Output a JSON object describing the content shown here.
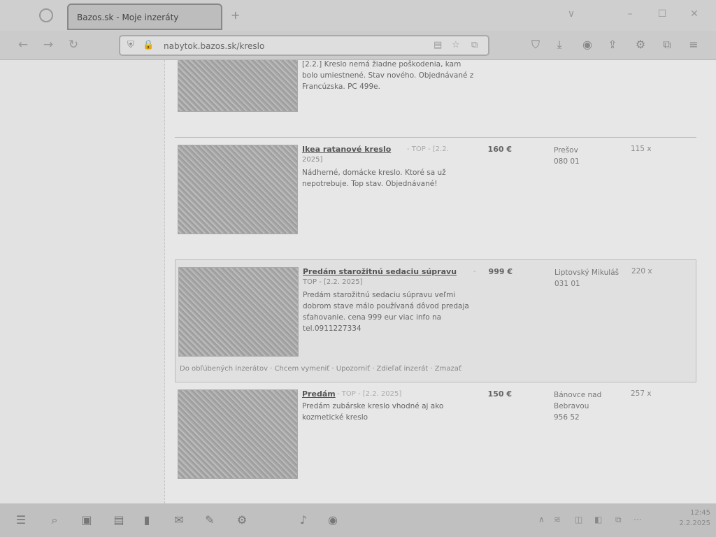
{
  "browser": {
    "tab_title": "Bazos.sk - Moje inzeráty",
    "new_tab": "+",
    "url": "nabytok.bazos.sk/kreslo",
    "window_controls": [
      "∨",
      "–",
      "☐",
      "✕"
    ],
    "icons": {
      "back": "←",
      "forward": "→",
      "reload": "↻",
      "shield": "⛨",
      "reader": "▤",
      "star": "☆",
      "extension": "⧉",
      "pocket": "⛉",
      "download": "⤓",
      "account": "◉",
      "lock": "🔒",
      "share": "⇪",
      "settings": "⚙",
      "menu": "≡"
    }
  },
  "listings": [
    {
      "partial": true,
      "desc": "[2.2.] Kreslo nemá žiadne poškodenia, kam bolo umiestnené. Stav nového. Objednávané z Francúzska. PC 499e."
    },
    {
      "title": "Ikea ratanové kreslo",
      "top": "- TOP - [2.2.",
      "date_cont": "2025]",
      "desc": "Nádherné, domácke kreslo. Ktoré sa už nepotrebuje. Top stav. Objednávané!",
      "price": "160 €",
      "location": "Prešov",
      "zip": "080 01",
      "views": "115 x"
    },
    {
      "title": "Predám starožitnú sedaciu súpravu",
      "top": "-",
      "date": "TOP - [2.2. 2025]",
      "desc": "Predám starožitnú sedaciu súpravu veľmi dobrom stave málo používaná dôvod predaja sťahovanie. cena 999 eur viac info na tel.0911227334",
      "price": "999 €",
      "location": "Liptovský Mikuláš",
      "zip": "031 01",
      "views": "220 x",
      "actions": "Do obľúbených inzerátov · Chcem vymeniť · Upozorniť · Zdieľať inzerát · Zmazať"
    },
    {
      "title": "Predám",
      "top": "- TOP - [2.2. 2025]",
      "desc": "Predám zubárske kreslo vhodné aj ako kozmetické kreslo",
      "price": "150 €",
      "location": "Bánovce nad Bebravou",
      "zip": "956 52",
      "views": "257 x"
    }
  ],
  "taskbar": {
    "icons": [
      "start-icon",
      "search-icon",
      "files-icon",
      "folder-icon",
      "terminal-icon",
      "store-icon",
      "mail-icon",
      "settings-icon",
      "music-icon",
      "browser-icon"
    ],
    "glyphs": [
      "☰",
      "⌕",
      "▣",
      "▤",
      "▮",
      "✉",
      "✎",
      "⚙",
      "♪",
      "◉"
    ],
    "tray": [
      "∧",
      "≋",
      "◫",
      "◧",
      "⧉",
      "⋯"
    ],
    "clock_time": "12:45",
    "clock_date": "2.2.2025"
  }
}
